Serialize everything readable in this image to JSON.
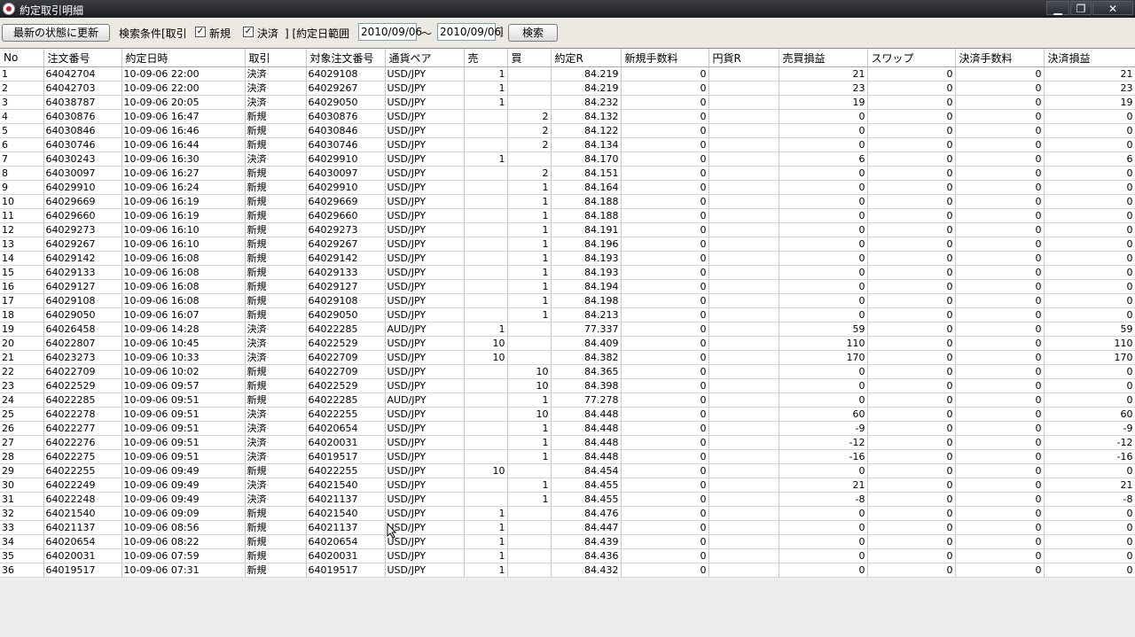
{
  "window": {
    "title": "約定取引明細",
    "minimize": "▁",
    "maximize": "❐",
    "close": "✕"
  },
  "toolbar": {
    "refresh_label": "最新の状態に更新",
    "search_conditions_label": "検索条件[取引",
    "new_label": "新規",
    "new_checked": true,
    "settle_label": "決済",
    "settle_checked": true,
    "date_range_label": "] [約定日範囲",
    "date_from": "2010/09/06",
    "tilde": "〜",
    "date_to": "2010/09/06",
    "bracket_close": "]",
    "search_label": "検索"
  },
  "columns": [
    "No",
    "注文番号",
    "約定日時",
    "取引",
    "対象注文番号",
    "通貨ペア",
    "売",
    "買",
    "約定R",
    "新規手数料",
    "円貨R",
    "売買損益",
    "スワップ",
    "決済手数料",
    "決済損益"
  ],
  "rows": [
    [
      "1",
      "64042704",
      "10-09-06 22:00",
      "決済",
      "64029108",
      "USD/JPY",
      "1",
      "",
      "84.219",
      "0",
      "",
      "21",
      "0",
      "0",
      "21"
    ],
    [
      "2",
      "64042703",
      "10-09-06 22:00",
      "決済",
      "64029267",
      "USD/JPY",
      "1",
      "",
      "84.219",
      "0",
      "",
      "23",
      "0",
      "0",
      "23"
    ],
    [
      "3",
      "64038787",
      "10-09-06 20:05",
      "決済",
      "64029050",
      "USD/JPY",
      "1",
      "",
      "84.232",
      "0",
      "",
      "19",
      "0",
      "0",
      "19"
    ],
    [
      "4",
      "64030876",
      "10-09-06 16:47",
      "新規",
      "64030876",
      "USD/JPY",
      "",
      "2",
      "84.132",
      "0",
      "",
      "0",
      "0",
      "0",
      "0"
    ],
    [
      "5",
      "64030846",
      "10-09-06 16:46",
      "新規",
      "64030846",
      "USD/JPY",
      "",
      "2",
      "84.122",
      "0",
      "",
      "0",
      "0",
      "0",
      "0"
    ],
    [
      "6",
      "64030746",
      "10-09-06 16:44",
      "新規",
      "64030746",
      "USD/JPY",
      "",
      "2",
      "84.134",
      "0",
      "",
      "0",
      "0",
      "0",
      "0"
    ],
    [
      "7",
      "64030243",
      "10-09-06 16:30",
      "決済",
      "64029910",
      "USD/JPY",
      "1",
      "",
      "84.170",
      "0",
      "",
      "6",
      "0",
      "0",
      "6"
    ],
    [
      "8",
      "64030097",
      "10-09-06 16:27",
      "新規",
      "64030097",
      "USD/JPY",
      "",
      "2",
      "84.151",
      "0",
      "",
      "0",
      "0",
      "0",
      "0"
    ],
    [
      "9",
      "64029910",
      "10-09-06 16:24",
      "新規",
      "64029910",
      "USD/JPY",
      "",
      "1",
      "84.164",
      "0",
      "",
      "0",
      "0",
      "0",
      "0"
    ],
    [
      "10",
      "64029669",
      "10-09-06 16:19",
      "新規",
      "64029669",
      "USD/JPY",
      "",
      "1",
      "84.188",
      "0",
      "",
      "0",
      "0",
      "0",
      "0"
    ],
    [
      "11",
      "64029660",
      "10-09-06 16:19",
      "新規",
      "64029660",
      "USD/JPY",
      "",
      "1",
      "84.188",
      "0",
      "",
      "0",
      "0",
      "0",
      "0"
    ],
    [
      "12",
      "64029273",
      "10-09-06 16:10",
      "新規",
      "64029273",
      "USD/JPY",
      "",
      "1",
      "84.191",
      "0",
      "",
      "0",
      "0",
      "0",
      "0"
    ],
    [
      "13",
      "64029267",
      "10-09-06 16:10",
      "新規",
      "64029267",
      "USD/JPY",
      "",
      "1",
      "84.196",
      "0",
      "",
      "0",
      "0",
      "0",
      "0"
    ],
    [
      "14",
      "64029142",
      "10-09-06 16:08",
      "新規",
      "64029142",
      "USD/JPY",
      "",
      "1",
      "84.193",
      "0",
      "",
      "0",
      "0",
      "0",
      "0"
    ],
    [
      "15",
      "64029133",
      "10-09-06 16:08",
      "新規",
      "64029133",
      "USD/JPY",
      "",
      "1",
      "84.193",
      "0",
      "",
      "0",
      "0",
      "0",
      "0"
    ],
    [
      "16",
      "64029127",
      "10-09-06 16:08",
      "新規",
      "64029127",
      "USD/JPY",
      "",
      "1",
      "84.194",
      "0",
      "",
      "0",
      "0",
      "0",
      "0"
    ],
    [
      "17",
      "64029108",
      "10-09-06 16:08",
      "新規",
      "64029108",
      "USD/JPY",
      "",
      "1",
      "84.198",
      "0",
      "",
      "0",
      "0",
      "0",
      "0"
    ],
    [
      "18",
      "64029050",
      "10-09-06 16:07",
      "新規",
      "64029050",
      "USD/JPY",
      "",
      "1",
      "84.213",
      "0",
      "",
      "0",
      "0",
      "0",
      "0"
    ],
    [
      "19",
      "64026458",
      "10-09-06 14:28",
      "決済",
      "64022285",
      "AUD/JPY",
      "1",
      "",
      "77.337",
      "0",
      "",
      "59",
      "0",
      "0",
      "59"
    ],
    [
      "20",
      "64022807",
      "10-09-06 10:45",
      "決済",
      "64022529",
      "USD/JPY",
      "10",
      "",
      "84.409",
      "0",
      "",
      "110",
      "0",
      "0",
      "110"
    ],
    [
      "21",
      "64023273",
      "10-09-06 10:33",
      "決済",
      "64022709",
      "USD/JPY",
      "10",
      "",
      "84.382",
      "0",
      "",
      "170",
      "0",
      "0",
      "170"
    ],
    [
      "22",
      "64022709",
      "10-09-06 10:02",
      "新規",
      "64022709",
      "USD/JPY",
      "",
      "10",
      "84.365",
      "0",
      "",
      "0",
      "0",
      "0",
      "0"
    ],
    [
      "23",
      "64022529",
      "10-09-06 09:57",
      "新規",
      "64022529",
      "USD/JPY",
      "",
      "10",
      "84.398",
      "0",
      "",
      "0",
      "0",
      "0",
      "0"
    ],
    [
      "24",
      "64022285",
      "10-09-06 09:51",
      "新規",
      "64022285",
      "AUD/JPY",
      "",
      "1",
      "77.278",
      "0",
      "",
      "0",
      "0",
      "0",
      "0"
    ],
    [
      "25",
      "64022278",
      "10-09-06 09:51",
      "決済",
      "64022255",
      "USD/JPY",
      "",
      "10",
      "84.448",
      "0",
      "",
      "60",
      "0",
      "0",
      "60"
    ],
    [
      "26",
      "64022277",
      "10-09-06 09:51",
      "決済",
      "64020654",
      "USD/JPY",
      "",
      "1",
      "84.448",
      "0",
      "",
      "-9",
      "0",
      "0",
      "-9"
    ],
    [
      "27",
      "64022276",
      "10-09-06 09:51",
      "決済",
      "64020031",
      "USD/JPY",
      "",
      "1",
      "84.448",
      "0",
      "",
      "-12",
      "0",
      "0",
      "-12"
    ],
    [
      "28",
      "64022275",
      "10-09-06 09:51",
      "決済",
      "64019517",
      "USD/JPY",
      "",
      "1",
      "84.448",
      "0",
      "",
      "-16",
      "0",
      "0",
      "-16"
    ],
    [
      "29",
      "64022255",
      "10-09-06 09:49",
      "新規",
      "64022255",
      "USD/JPY",
      "10",
      "",
      "84.454",
      "0",
      "",
      "0",
      "0",
      "0",
      "0"
    ],
    [
      "30",
      "64022249",
      "10-09-06 09:49",
      "決済",
      "64021540",
      "USD/JPY",
      "",
      "1",
      "84.455",
      "0",
      "",
      "21",
      "0",
      "0",
      "21"
    ],
    [
      "31",
      "64022248",
      "10-09-06 09:49",
      "決済",
      "64021137",
      "USD/JPY",
      "",
      "1",
      "84.455",
      "0",
      "",
      "-8",
      "0",
      "0",
      "-8"
    ],
    [
      "32",
      "64021540",
      "10-09-06 09:09",
      "新規",
      "64021540",
      "USD/JPY",
      "1",
      "",
      "84.476",
      "0",
      "",
      "0",
      "0",
      "0",
      "0"
    ],
    [
      "33",
      "64021137",
      "10-09-06 08:56",
      "新規",
      "64021137",
      "USD/JPY",
      "1",
      "",
      "84.447",
      "0",
      "",
      "0",
      "0",
      "0",
      "0"
    ],
    [
      "34",
      "64020654",
      "10-09-06 08:22",
      "新規",
      "64020654",
      "USD/JPY",
      "1",
      "",
      "84.439",
      "0",
      "",
      "0",
      "0",
      "0",
      "0"
    ],
    [
      "35",
      "64020031",
      "10-09-06 07:59",
      "新規",
      "64020031",
      "USD/JPY",
      "1",
      "",
      "84.436",
      "0",
      "",
      "0",
      "0",
      "0",
      "0"
    ],
    [
      "36",
      "64019517",
      "10-09-06 07:31",
      "新規",
      "64019517",
      "USD/JPY",
      "1",
      "",
      "84.432",
      "0",
      "",
      "0",
      "0",
      "0",
      "0"
    ]
  ]
}
